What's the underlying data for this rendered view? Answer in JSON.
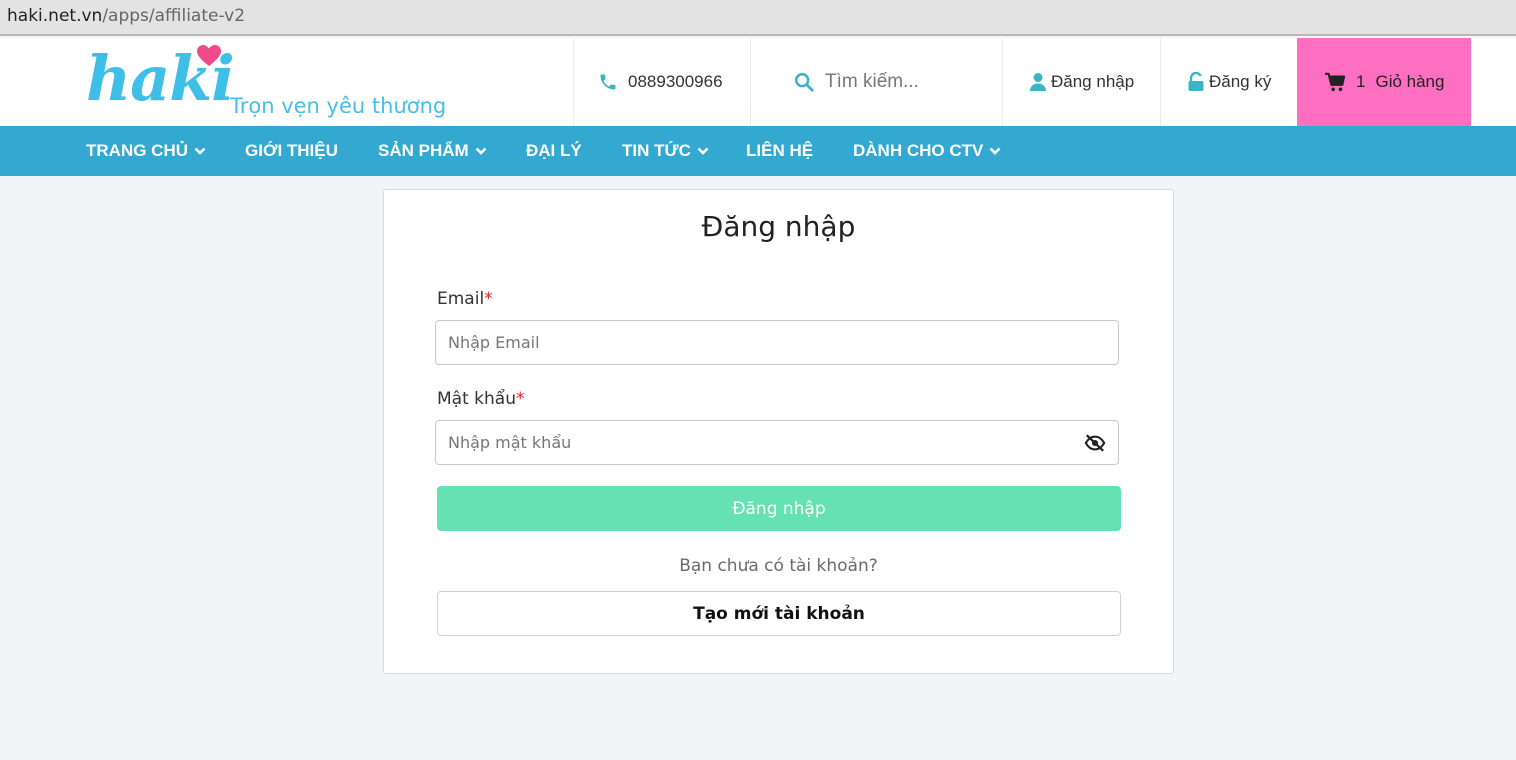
{
  "browser": {
    "url_host": "haki.net.vn",
    "url_path": "/apps/affiliate-v2"
  },
  "header": {
    "logo_text": "haki",
    "logo_tagline": "Trọn vẹn yêu thương",
    "phone": "0889300966",
    "search_placeholder": "Tìm kiếm...",
    "login_label": "Đăng nhập",
    "register_label": "Đăng ký",
    "cart_count": "1",
    "cart_label": "Giỏ hàng"
  },
  "nav": {
    "items": [
      {
        "label": "TRANG CHỦ",
        "dropdown": true
      },
      {
        "label": "GIỚI THIỆU",
        "dropdown": false
      },
      {
        "label": "SẢN PHẨM",
        "dropdown": true
      },
      {
        "label": "ĐẠI LÝ",
        "dropdown": false
      },
      {
        "label": "TIN TỨC",
        "dropdown": true
      },
      {
        "label": "LIÊN HỆ",
        "dropdown": false
      },
      {
        "label": "DÀNH CHO CTV",
        "dropdown": true
      }
    ]
  },
  "form": {
    "title": "Đăng nhập",
    "email_label": "Email",
    "required_mark": "*",
    "email_placeholder": "Nhập Email",
    "email_value": "",
    "password_label": "Mật khẩu",
    "password_placeholder": "Nhập mật khẩu",
    "password_value": "",
    "submit_label": "Đăng nhập",
    "no_account_text": "Bạn chưa có tài khoản?",
    "create_label": "Tạo mới tài khoản"
  },
  "colors": {
    "brand_blue": "#33a9d2",
    "cart_pink": "#ff6fc1",
    "submit_green": "#66e1b3",
    "icon_teal": "#3bb5c5"
  },
  "icons": [
    "phone-icon",
    "search-icon",
    "user-icon",
    "unlock-icon",
    "cart-icon",
    "chevron-down-icon",
    "eye-slash-icon",
    "heart-icon"
  ]
}
